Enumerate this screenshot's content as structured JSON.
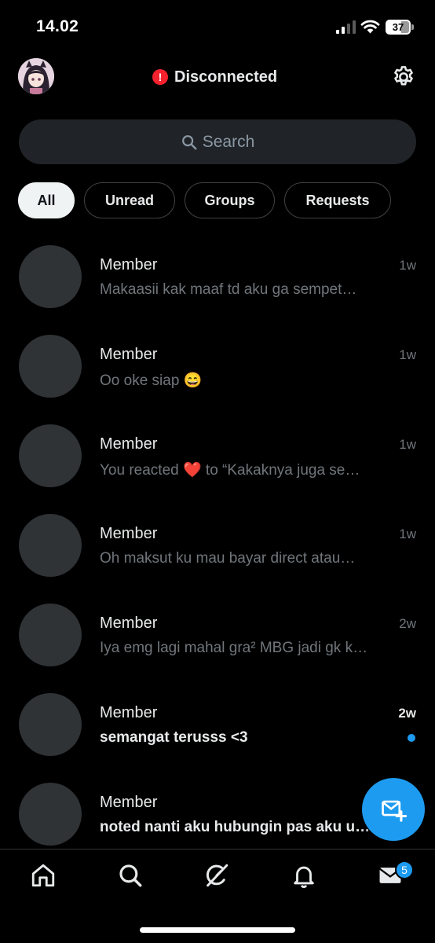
{
  "status_bar": {
    "time": "14.02",
    "battery": "37"
  },
  "header": {
    "connection_status": "Disconnected"
  },
  "search": {
    "placeholder": "Search"
  },
  "filters": [
    "All",
    "Unread",
    "Groups",
    "Requests"
  ],
  "conversations": [
    {
      "name": "Member",
      "snippet": "Makaasii kak maaf td aku ga sempet…",
      "time": "1w",
      "unread": false
    },
    {
      "name": "Member",
      "snippet": "Oo oke siap 😄",
      "time": "1w",
      "unread": false
    },
    {
      "name": "Member",
      "snippet": "You reacted ❤️ to “Kakaknya juga se…",
      "time": "1w",
      "unread": false
    },
    {
      "name": "Member",
      "snippet": "Oh maksut ku mau bayar direct atau…",
      "time": "1w",
      "unread": false
    },
    {
      "name": "Member",
      "snippet": "Iya emg lagi mahal gra² MBG jadi gk k…",
      "time": "2w",
      "unread": false
    },
    {
      "name": "Member",
      "snippet": "semangat terusss <3",
      "time": "2w",
      "unread": true
    },
    {
      "name": "Member",
      "snippet": "noted nanti aku hubungin pas aku u…",
      "time": "",
      "unread": true
    }
  ],
  "bottom_nav": {
    "items": [
      "home-icon",
      "search-icon",
      "grok-icon",
      "bell-icon",
      "mail-icon"
    ],
    "messages_badge": "5"
  },
  "colors": {
    "accent": "#1d9bf0",
    "error": "#f4212e",
    "background": "#000000"
  }
}
